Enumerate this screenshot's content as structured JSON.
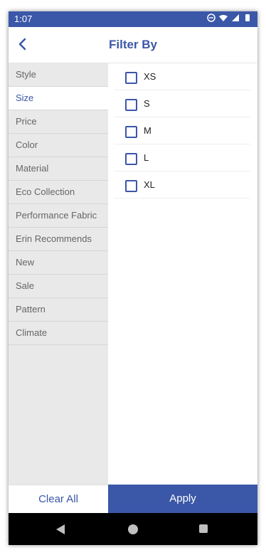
{
  "status": {
    "time": "1:07",
    "icons": [
      "do-not-disturb-icon",
      "wifi-icon",
      "signal-icon",
      "battery-icon"
    ]
  },
  "header": {
    "title": "Filter By",
    "back_icon": "chevron-left-icon"
  },
  "categories": [
    {
      "label": "Style"
    },
    {
      "label": "Size"
    },
    {
      "label": "Price"
    },
    {
      "label": "Color"
    },
    {
      "label": "Material"
    },
    {
      "label": "Eco Collection"
    },
    {
      "label": "Performance Fabric"
    },
    {
      "label": "Erin Recommends"
    },
    {
      "label": "New"
    },
    {
      "label": "Sale"
    },
    {
      "label": "Pattern"
    },
    {
      "label": "Climate"
    }
  ],
  "active_category": "Size",
  "size_options": [
    {
      "label": "XS",
      "checked": false
    },
    {
      "label": "S",
      "checked": false
    },
    {
      "label": "M",
      "checked": false
    },
    {
      "label": "L",
      "checked": false
    },
    {
      "label": "XL",
      "checked": false
    }
  ],
  "buttons": {
    "clear": "Clear All",
    "apply": "Apply"
  },
  "colors": {
    "primary": "#3b57a8",
    "sidebar_bg": "#e9e9e9"
  }
}
